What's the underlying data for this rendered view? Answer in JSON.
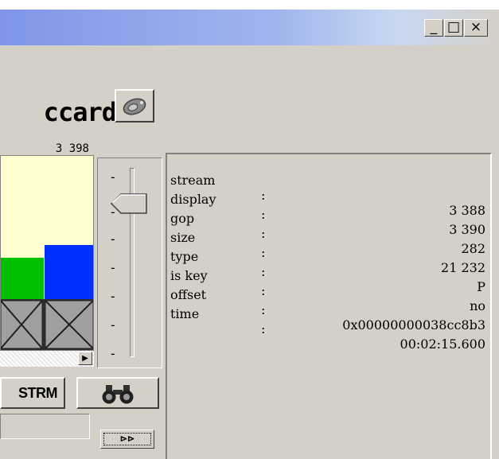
{
  "window": {
    "caption_buttons": {
      "minimize": "_",
      "maximize": "□",
      "close": "×"
    }
  },
  "logo": {
    "text": "ccard"
  },
  "frame_counter": "3 398",
  "info": {
    "rows": [
      {
        "key": "stream",
        "sep": ":",
        "value": "3 388"
      },
      {
        "key": "display",
        "sep": ":",
        "value": "3 390"
      },
      {
        "key": "gop",
        "sep": ":",
        "value": "282"
      },
      {
        "key": "size",
        "sep": ":",
        "value": "21 232"
      },
      {
        "key": "type",
        "sep": ":",
        "value": "P"
      },
      {
        "key": "is key",
        "sep": ":",
        "value": "no"
      },
      {
        "key": "offset",
        "sep": ":",
        "value": "0x00000000038cc8b3"
      },
      {
        "key": "time",
        "sep": ":",
        "value": "00:02:15.600"
      }
    ]
  },
  "buttons": {
    "strm_label": "STRM",
    "ff_label": "⊳⊳"
  },
  "slider": {
    "tick_label": "-"
  },
  "icons": {
    "camera": "camera-icon",
    "binoculars": "binoculars-icon",
    "scroll_right": "▶"
  },
  "colors": {
    "title_gradient_start": "#7f96e8",
    "face": "#d4d0c8",
    "video_bg": "#ffffd0",
    "green_block": "#00c000",
    "blue_block": "#0030ff"
  }
}
